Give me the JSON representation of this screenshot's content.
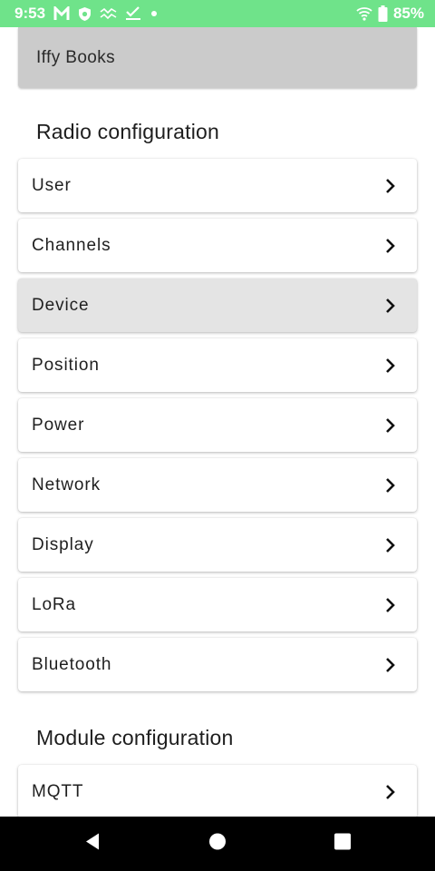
{
  "status_bar": {
    "time": "9:53",
    "battery": "85%",
    "icons": [
      "gmail-icon",
      "shield-icon",
      "wave-icon",
      "checkmark-icon",
      "dot-icon",
      "wifi-icon",
      "battery-icon"
    ]
  },
  "node": {
    "name": "Iffy Books"
  },
  "radio_section": {
    "title": "Radio configuration",
    "items": [
      {
        "label": "User"
      },
      {
        "label": "Channels"
      },
      {
        "label": "Device"
      },
      {
        "label": "Position"
      },
      {
        "label": "Power"
      },
      {
        "label": "Network"
      },
      {
        "label": "Display"
      },
      {
        "label": "LoRa"
      },
      {
        "label": "Bluetooth"
      }
    ]
  },
  "module_section": {
    "title": "Module configuration",
    "items": [
      {
        "label": "MQTT"
      }
    ]
  },
  "nav_bar": {
    "icons": [
      "back-icon",
      "home-icon",
      "recents-icon"
    ]
  },
  "colors": {
    "status_bar": "#6fe38a",
    "node_bar": "#cbcbcb",
    "pressed_item": "#e4e4e4"
  }
}
